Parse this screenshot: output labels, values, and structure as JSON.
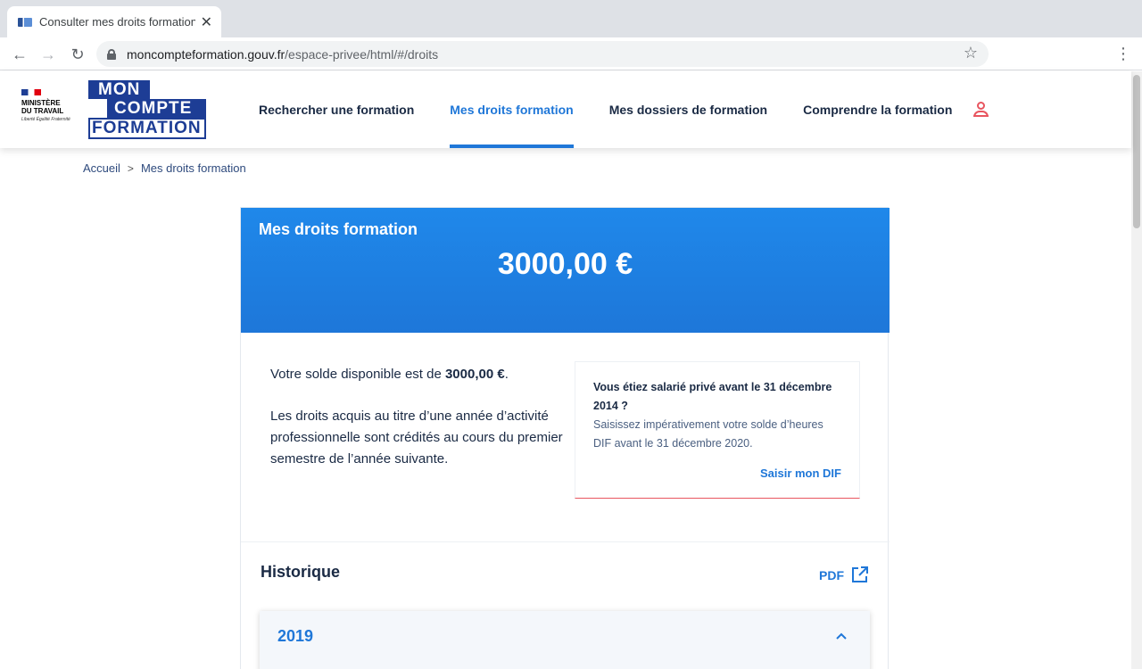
{
  "browser": {
    "tab_title": "Consulter mes droits formation",
    "tab_close": "✕",
    "url_host": "moncompteformation.gouv.fr",
    "url_path": "/espace-privee/html/#/droits"
  },
  "header": {
    "ministry": {
      "name_line1": "MINISTÈRE",
      "name_line2": "DU TRAVAIL",
      "motto": "Liberté Égalité Fraternité"
    },
    "logo": {
      "line1": "MON",
      "line2": "COMPTE",
      "line3": "FORMATION"
    },
    "nav": [
      {
        "label": "Rechercher une formation"
      },
      {
        "label": "Mes droits formation"
      },
      {
        "label": "Mes dossiers de formation"
      },
      {
        "label": "Comprendre la formation"
      }
    ]
  },
  "breadcrumb": {
    "home": "Accueil",
    "separator": ">",
    "current": "Mes droits formation"
  },
  "banner": {
    "title": "Mes droits formation",
    "amount": "3000,00 €"
  },
  "solde": {
    "prefix": "Votre solde disponible est de ",
    "amount": "3000,00 €",
    "suffix": "."
  },
  "droits_text": "Les droits acquis au titre d’une année d’activité professionnelle sont crédités au cours du premier semestre de l’année suivante.",
  "dif": {
    "question": "Vous étiez salarié privé avant le 31 décembre 2014 ?",
    "description": "Saisissez impérativement votre solde d’heures DIF avant le 31 décembre 2020.",
    "link": "Saisir mon DIF"
  },
  "historique": {
    "title": "Historique",
    "pdf_label": "PDF",
    "year": "2019"
  },
  "colors": {
    "primary": "#1f77d8",
    "navy": "#1d3d95",
    "accent_red": "#e8555f"
  }
}
